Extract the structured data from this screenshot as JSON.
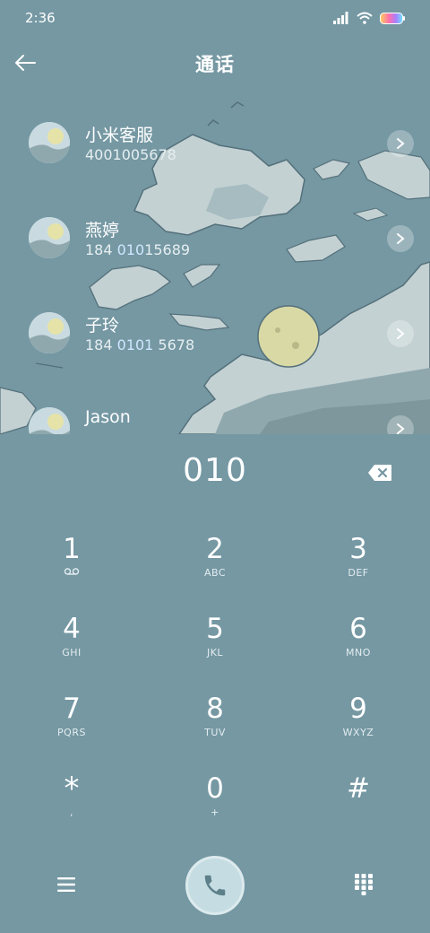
{
  "status_bar": {
    "time": "2:36",
    "icons": [
      "signal-icon",
      "wifi-icon",
      "battery-icon"
    ]
  },
  "header": {
    "title": "通话",
    "back_icon": "back-arrow-icon"
  },
  "contacts": [
    {
      "name": "小米客服",
      "number_plain": "4001005678",
      "number_prefix": "",
      "number_highlight": "",
      "number_suffix": ""
    },
    {
      "name": "燕婷",
      "number_plain": "",
      "number_prefix": "184 ",
      "number_highlight": "010",
      "number_suffix": "15689"
    },
    {
      "name": "子玲",
      "number_plain": "",
      "number_prefix": "184 ",
      "number_highlight": "0101",
      "number_suffix": " 5678"
    },
    {
      "name": "Jason",
      "number_plain": "",
      "number_prefix": "",
      "number_highlight": "",
      "number_suffix": ""
    }
  ],
  "dialer": {
    "entered_number": "010",
    "backspace_icon": "backspace-icon"
  },
  "keypad": [
    {
      "digit": "1",
      "letters": "",
      "icon": "voicemail-icon"
    },
    {
      "digit": "2",
      "letters": "ABC"
    },
    {
      "digit": "3",
      "letters": "DEF"
    },
    {
      "digit": "4",
      "letters": "GHI"
    },
    {
      "digit": "5",
      "letters": "JKL"
    },
    {
      "digit": "6",
      "letters": "MNO"
    },
    {
      "digit": "7",
      "letters": "PQRS"
    },
    {
      "digit": "8",
      "letters": "TUV"
    },
    {
      "digit": "9",
      "letters": "WXYZ"
    },
    {
      "digit": "*",
      "letters": ","
    },
    {
      "digit": "0",
      "letters": "+"
    },
    {
      "digit": "#",
      "letters": ""
    }
  ],
  "bottom_bar": {
    "menu_icon": "menu-icon",
    "call_icon": "phone-icon",
    "keypad_icon": "dialpad-icon"
  },
  "colors": {
    "background": "#7598a3",
    "map_land": "#c3d1d3",
    "map_land_dark": "#8fa8ad",
    "moon": "#d9d9a6",
    "call_button": "#c5dde2"
  }
}
